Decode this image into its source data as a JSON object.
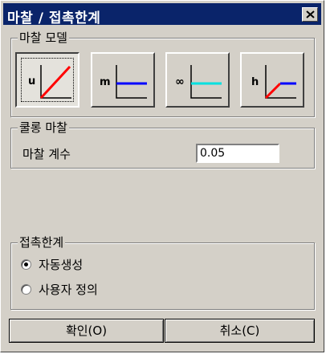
{
  "window": {
    "title": "마찰 / 접촉한계"
  },
  "friction_model": {
    "group_title": "마찰 모델",
    "buttons": [
      {
        "key": "u",
        "selected": true,
        "line_color": "#ff0000"
      },
      {
        "key": "m",
        "selected": false,
        "line_color": "#0000ff"
      },
      {
        "key": "∞",
        "selected": false,
        "line_color": "#00e0e0"
      },
      {
        "key": "h",
        "selected": false,
        "line_color": "#ff0000",
        "line_color2": "#0000ff"
      }
    ]
  },
  "coulomb": {
    "group_title": "쿨롱 마찰",
    "coefficient_label": "마찰 계수",
    "coefficient_value": "0.05"
  },
  "contact_limit": {
    "group_title": "접촉한계",
    "options": [
      {
        "label": "자동생성",
        "checked": true
      },
      {
        "label": "사용자 정의",
        "checked": false
      }
    ]
  },
  "buttons": {
    "ok_label": "확인(O)",
    "cancel_label": "취소(C)"
  }
}
